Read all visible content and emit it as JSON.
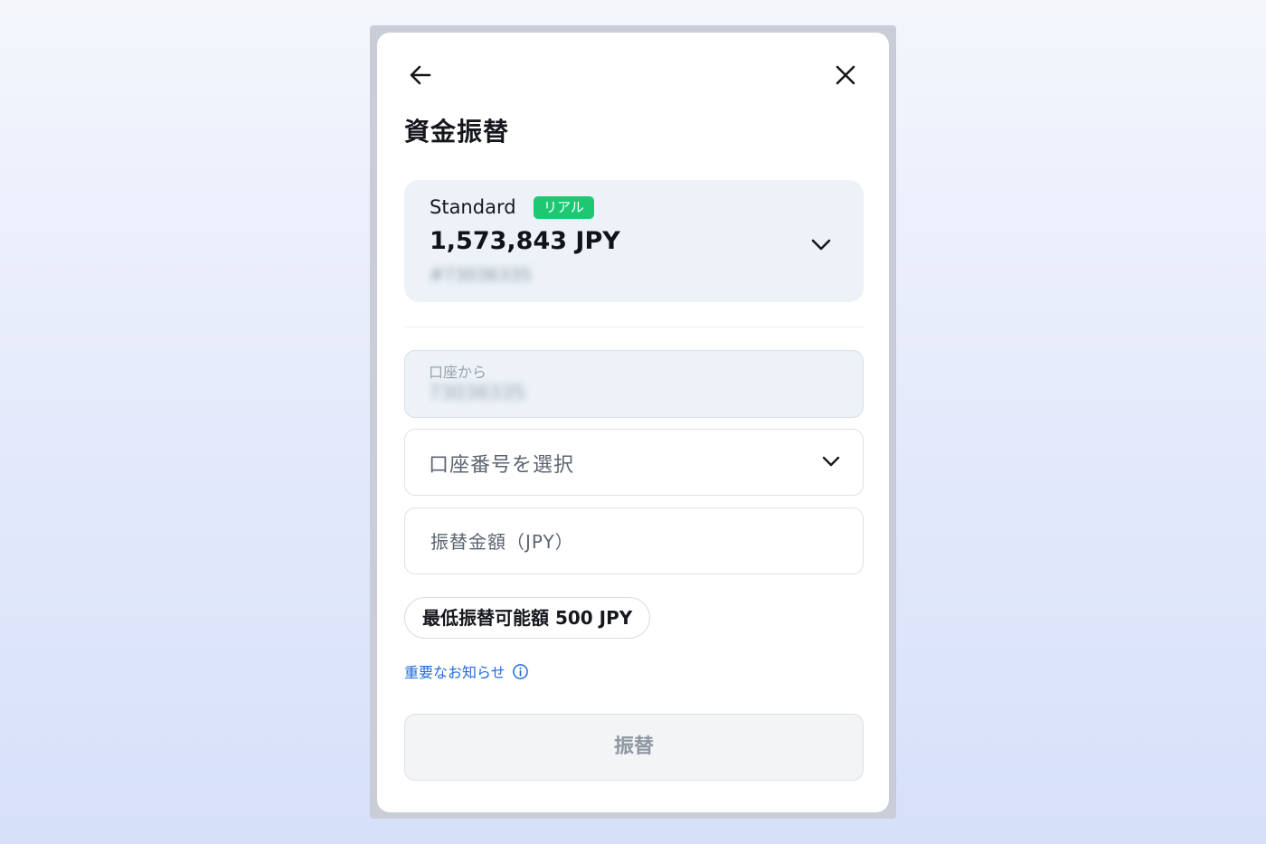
{
  "dialog": {
    "title": "資金振替",
    "back_icon": "arrow-left-icon",
    "close_icon": "close-icon"
  },
  "account_card": {
    "account_type": "Standard",
    "badge": "リアル",
    "badge_color": "#1ec873",
    "balance": "1,573,843 JPY",
    "account_number": "#73036335",
    "chevron_icon": "chevron-down-icon"
  },
  "from_field": {
    "label": "口座から",
    "value": "73036335"
  },
  "to_select": {
    "placeholder": "口座番号を選択",
    "chevron_icon": "chevron-down-icon"
  },
  "amount_field": {
    "placeholder": "振替金額（JPY）",
    "value": ""
  },
  "min_transfer": "最低振替可能額 500 JPY",
  "notice": {
    "label": "重要なお知らせ",
    "icon": "info-icon",
    "color": "#1f6bdb"
  },
  "submit_button": {
    "label": "振替",
    "state": "disabled"
  }
}
